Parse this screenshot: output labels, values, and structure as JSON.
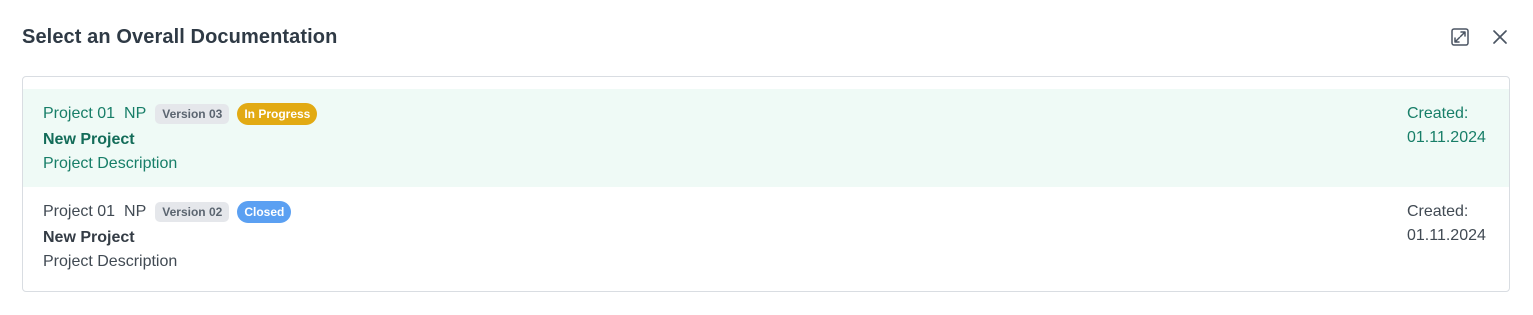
{
  "dialog": {
    "title": "Select an Overall Documentation",
    "actions": [
      {
        "name": "expand",
        "icon": "expand-icon"
      },
      {
        "name": "close",
        "icon": "close-icon"
      }
    ]
  },
  "items": [
    {
      "code": "Project 01",
      "abbr": "NP",
      "version": "Version 03",
      "status": "In Progress",
      "status_color": "#e2aa13",
      "name": "New Project",
      "description": "Project Description",
      "created_label": "Created:",
      "created_date": "01.11.2024",
      "selected": true
    },
    {
      "code": "Project 01",
      "abbr": "NP",
      "version": "Version 02",
      "status": "Closed",
      "status_color": "#5ba0f2",
      "name": "New Project",
      "description": "Project Description",
      "created_label": "Created:",
      "created_date": "01.11.2024",
      "selected": false
    }
  ],
  "colors": {
    "accent": "#177e68",
    "selected_bg": "#effaf6"
  }
}
